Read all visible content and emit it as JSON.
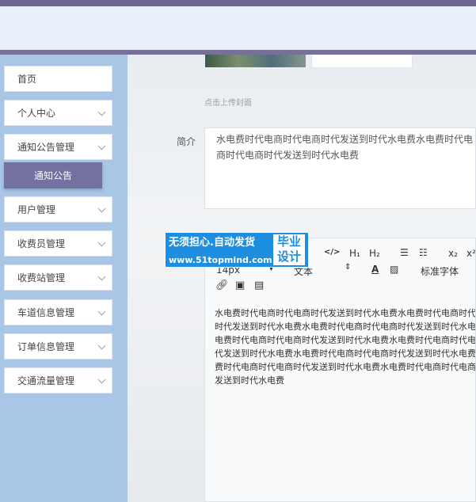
{
  "sidebar": {
    "items": [
      {
        "label": "首页"
      },
      {
        "label": "个人中心"
      },
      {
        "label": "通知公告管理"
      },
      {
        "label": "用户管理"
      },
      {
        "label": "收费员管理"
      },
      {
        "label": "收费站管理"
      },
      {
        "label": "车道信息管理"
      },
      {
        "label": "订单信息管理"
      },
      {
        "label": "交通流量管理"
      }
    ],
    "submenu": {
      "label": "通知公告"
    }
  },
  "form": {
    "upload_hint": "点击上传封面",
    "intro_label": "简介",
    "intro_value": "水电费时代电商时代电商时代发送到时代水电费水电费时代电商时代电商时代发送到时代水电费"
  },
  "editor": {
    "toolbar": {
      "h1": "H₁",
      "h2": "H₂",
      "subscript": "x₂",
      "superscript": "x²",
      "font_size": "14px",
      "text_type": "文本",
      "font_family": "标准字体"
    },
    "content": "水电费时代电商时代电商时代发送到时代水电费水电费时代电商时代电商时代发送到时代水电费水电费时代电商时代电商时代发送到时代水电费水电费时代电商时代电商时代发送到时代水电费水电费时代电商时代电商时代发送到时代水电费水电费时代电商时代电商时代发送到时代水电费水电费时代电商时代电商时代发送到时代水电费水电费时代电商时代电商时代发送到时代水电费"
  },
  "watermark": {
    "line1": "无须担心.自动发货",
    "line2": "www.51topmind.com",
    "badge": "毕业设计"
  },
  "colors": {
    "sidebar_bg": "#a9c6e6",
    "accent": "#7470a0",
    "header_bg": "#e8f0fa"
  }
}
